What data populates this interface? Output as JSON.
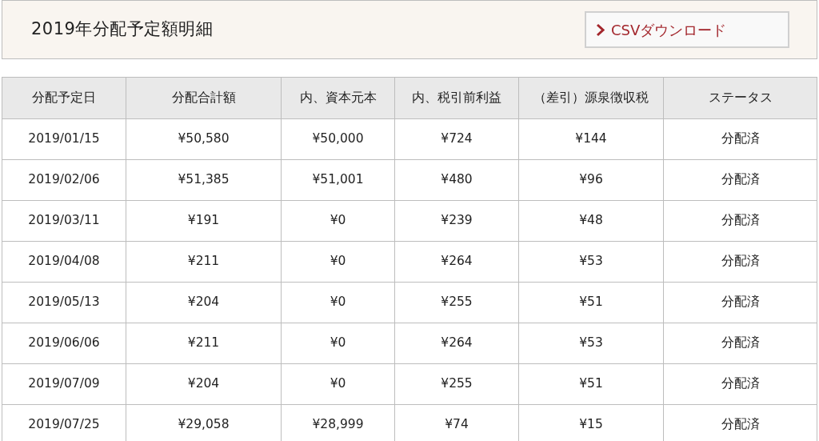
{
  "title": "2019年分配予定額明細",
  "download_button": "CSVダウンロード",
  "table": {
    "columns": [
      "分配予定日",
      "分配合計額",
      "内、資本元本",
      "内、税引前利益",
      "（差引）源泉徴収税",
      "ステータス"
    ],
    "rows": [
      [
        "2019/01/15",
        "¥50,580",
        "¥50,000",
        "¥724",
        "¥144",
        "分配済"
      ],
      [
        "2019/02/06",
        "¥51,385",
        "¥51,001",
        "¥480",
        "¥96",
        "分配済"
      ],
      [
        "2019/03/11",
        "¥191",
        "¥0",
        "¥239",
        "¥48",
        "分配済"
      ],
      [
        "2019/04/08",
        "¥211",
        "¥0",
        "¥264",
        "¥53",
        "分配済"
      ],
      [
        "2019/05/13",
        "¥204",
        "¥0",
        "¥255",
        "¥51",
        "分配済"
      ],
      [
        "2019/06/06",
        "¥211",
        "¥0",
        "¥264",
        "¥53",
        "分配済"
      ],
      [
        "2019/07/09",
        "¥204",
        "¥0",
        "¥255",
        "¥51",
        "分配済"
      ],
      [
        "2019/07/25",
        "¥29,058",
        "¥28,999",
        "¥74",
        "¥15",
        "分配済"
      ]
    ]
  }
}
